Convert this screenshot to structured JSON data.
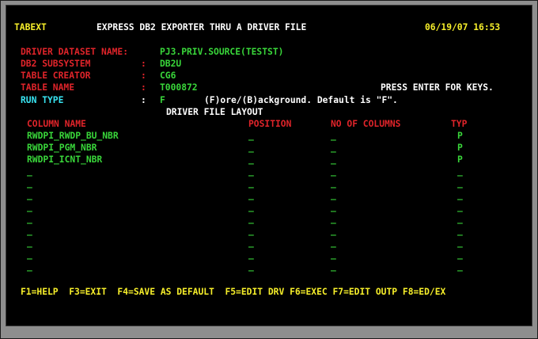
{
  "header": {
    "panel_id": "TABEXT",
    "title": "EXPRESS DB2 EXPORTER THRU A DRIVER FILE",
    "date_time": "06/19/07 16:53"
  },
  "fields": {
    "dataset": {
      "label": "DRIVER DATASET NAME:",
      "value": "PJ3.PRIV.SOURCE(TESTST)"
    },
    "subsystem": {
      "label": "DB2 SUBSYSTEM",
      "colon": ":",
      "value": "DB2U"
    },
    "creator": {
      "label": "TABLE CREATOR",
      "colon": ":",
      "value": "CG6"
    },
    "table": {
      "label": "TABLE NAME",
      "colon": ":",
      "value": "T000872"
    },
    "run_type": {
      "label": "RUN TYPE",
      "colon": ":",
      "value": "F",
      "hint": "(F)ore/(B)ackground. Default is \"F\"."
    }
  },
  "press_enter": "PRESS ENTER FOR KEYS.",
  "layout": {
    "title": "DRIVER FILE LAYOUT",
    "headers": {
      "column_name": "COLUMN NAME",
      "position": "POSITION",
      "num_columns": "NO OF COLUMNS",
      "type": "TYP"
    },
    "rows": [
      {
        "name": "RWDPI_RWDP_BU_NBR",
        "position": "_",
        "num": "_",
        "type": "P"
      },
      {
        "name": "RWDPI_PGM_NBR",
        "position": "_",
        "num": "_",
        "type": "P"
      },
      {
        "name": "RWDPI_ICNT_NBR",
        "position": "_",
        "num": "_",
        "type": "P"
      },
      {
        "name": "_",
        "position": "_",
        "num": "_",
        "type": "_"
      },
      {
        "name": "_",
        "position": "_",
        "num": "_",
        "type": "_"
      },
      {
        "name": "_",
        "position": "_",
        "num": "_",
        "type": "_"
      },
      {
        "name": "_",
        "position": "_",
        "num": "_",
        "type": "_"
      },
      {
        "name": "_",
        "position": "_",
        "num": "_",
        "type": "_"
      },
      {
        "name": "_",
        "position": "_",
        "num": "_",
        "type": "_"
      },
      {
        "name": "_",
        "position": "_",
        "num": "_",
        "type": "_"
      },
      {
        "name": "_",
        "position": "_",
        "num": "_",
        "type": "_"
      },
      {
        "name": "_",
        "position": "_",
        "num": "_",
        "type": "_"
      }
    ]
  },
  "function_keys": "F1=HELP  F3=EXIT  F4=SAVE AS DEFAULT  F5=EDIT DRV F6=EXEC F7=EDIT OUTP F8=ED/EX",
  "colors": {
    "yellow": "#f7ef2a",
    "white": "#ffffff",
    "red": "#e0242a",
    "green": "#39d63a",
    "cyan": "#38e4f2",
    "background": "#000000"
  }
}
